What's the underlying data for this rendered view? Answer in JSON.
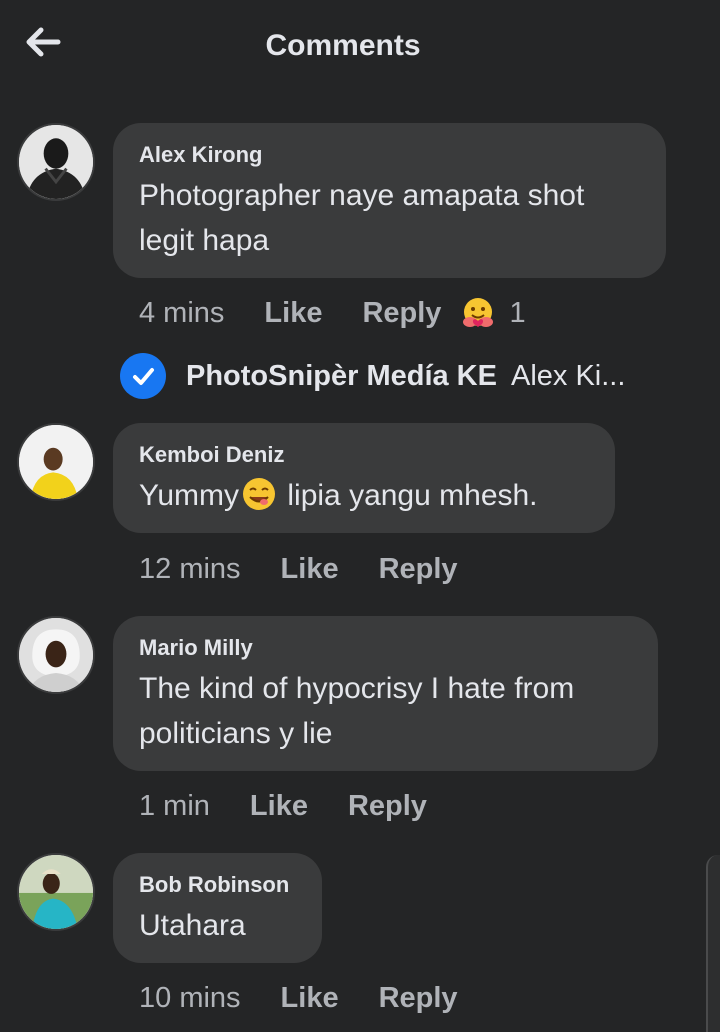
{
  "header": {
    "title": "Comments"
  },
  "comments": [
    {
      "author": "Alex Kirong",
      "text": "Photographer naye amapata shot legit hapa",
      "time": "4 mins",
      "like": "Like",
      "reply": "Reply",
      "reaction_icon": "hug-emoji-icon",
      "reaction_count": "1"
    },
    {
      "author": "Kemboi Deniz",
      "text_before": "Yummy",
      "text_emoji": "savoring-food-emoji-icon",
      "text_after": " lipia yangu mhesh.",
      "time": "12 mins",
      "like": "Like",
      "reply": "Reply"
    },
    {
      "author": "Mario Milly",
      "text": "The kind of hypocrisy I hate from politicians y lie",
      "time": "1 min",
      "like": "Like",
      "reply": "Reply"
    },
    {
      "author": "Bob Robinson",
      "text": "Utahara",
      "time": "10 mins",
      "like": "Like",
      "reply": "Reply"
    }
  ],
  "reply_preview": {
    "author": "PhotoSnipèr Medía KE",
    "text": "Alex Ki...",
    "badge": "verified-check-icon"
  },
  "colors": {
    "background": "#242526",
    "bubble": "#3a3b3c",
    "text": "#e4e6eb",
    "muted": "#b0b3b8",
    "verified": "#1877f2"
  }
}
